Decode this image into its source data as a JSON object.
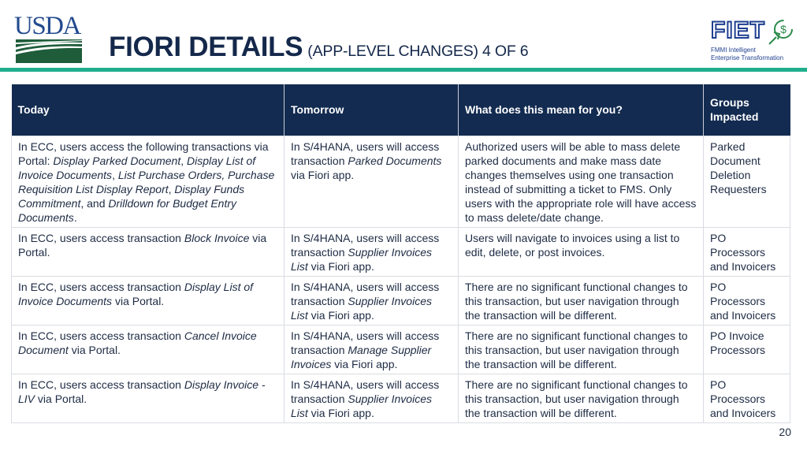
{
  "header": {
    "usda_logo_text": "USDA",
    "title": "FIORI DETAILS",
    "subtitle": "(APP-LEVEL CHANGES) 4 OF 6",
    "fiet_logo": {
      "word": "FIET",
      "line1": "FMMI Intelligent",
      "line2": "Enterprise Transformation",
      "icon": "dollar-cursor-icon"
    }
  },
  "colors": {
    "title": "#14284b",
    "accent_rule": "#1fae8c",
    "table_header_bg": "#132b50",
    "usda_blue": "#234a8f",
    "usda_green": "#1e5c3a"
  },
  "table": {
    "headers": [
      "Today",
      "Tomorrow",
      "What does this mean for you?",
      "Groups Impacted"
    ],
    "rows": [
      {
        "today": [
          {
            "t": "In ECC, users access the following transactions via Portal: "
          },
          {
            "t": "Display Parked Document",
            "i": true
          },
          {
            "t": ", "
          },
          {
            "t": "Display List of Invoice Documents",
            "i": true
          },
          {
            "t": ", "
          },
          {
            "t": "List Purchase Orders, Purchase Requisition List Display Report",
            "i": true
          },
          {
            "t": ", "
          },
          {
            "t": "Display Funds Commitment",
            "i": true
          },
          {
            "t": ", and "
          },
          {
            "t": "Drilldown for Budget Entry Documents",
            "i": true
          },
          {
            "t": "."
          }
        ],
        "tomorrow": [
          {
            "t": "In S/4HANA, users will access transaction "
          },
          {
            "t": "Parked Documents",
            "i": true
          },
          {
            "t": " via Fiori app."
          }
        ],
        "meaning": "Authorized users will be able to mass delete parked documents and make mass date changes themselves using one transaction instead of submitting a ticket to FMS. Only users with the appropriate role will have access to mass delete/date change.",
        "groups": "Parked Document Deletion Requesters"
      },
      {
        "today": [
          {
            "t": "In ECC, users access transaction "
          },
          {
            "t": "Block Invoice",
            "i": true
          },
          {
            "t": " via Portal."
          }
        ],
        "tomorrow": [
          {
            "t": "In S/4HANA, users will access transaction "
          },
          {
            "t": "Supplier Invoices List",
            "i": true
          },
          {
            "t": " via Fiori app."
          }
        ],
        "meaning": "Users will navigate to invoices using a list to edit, delete, or post invoices.",
        "groups": "PO Processors and Invoicers"
      },
      {
        "today": [
          {
            "t": "In ECC, users access transaction "
          },
          {
            "t": "Display List of Invoice Documents",
            "i": true
          },
          {
            "t": " via Portal."
          }
        ],
        "tomorrow": [
          {
            "t": "In S/4HANA, users will access transaction "
          },
          {
            "t": "Supplier Invoices List",
            "i": true
          },
          {
            "t": " via Fiori app."
          }
        ],
        "meaning": "There are no significant functional changes to this transaction, but user navigation through the transaction will be different.",
        "groups": "PO Processors and Invoicers"
      },
      {
        "today": [
          {
            "t": "In ECC, users access transaction "
          },
          {
            "t": "Cancel Invoice Document",
            "i": true
          },
          {
            "t": " via Portal."
          }
        ],
        "tomorrow": [
          {
            "t": "In S/4HANA, users will access transaction "
          },
          {
            "t": "Manage Supplier Invoices",
            "i": true
          },
          {
            "t": " via Fiori app."
          }
        ],
        "meaning": "There are no significant functional changes to this transaction, but user navigation through the transaction will be different.",
        "groups": "PO Invoice Processors"
      },
      {
        "today": [
          {
            "t": "In ECC, users access transaction "
          },
          {
            "t": "Display Invoice - LIV",
            "i": true
          },
          {
            "t": " via Portal."
          }
        ],
        "tomorrow": [
          {
            "t": "In S/4HANA, users will access transaction "
          },
          {
            "t": "Supplier Invoices List",
            "i": true
          },
          {
            "t": " via Fiori app."
          }
        ],
        "meaning": "There are no significant functional changes to this transaction, but user navigation through the transaction will be different.",
        "groups": "PO Processors and Invoicers"
      }
    ]
  },
  "footer": {
    "page_number": "20"
  }
}
